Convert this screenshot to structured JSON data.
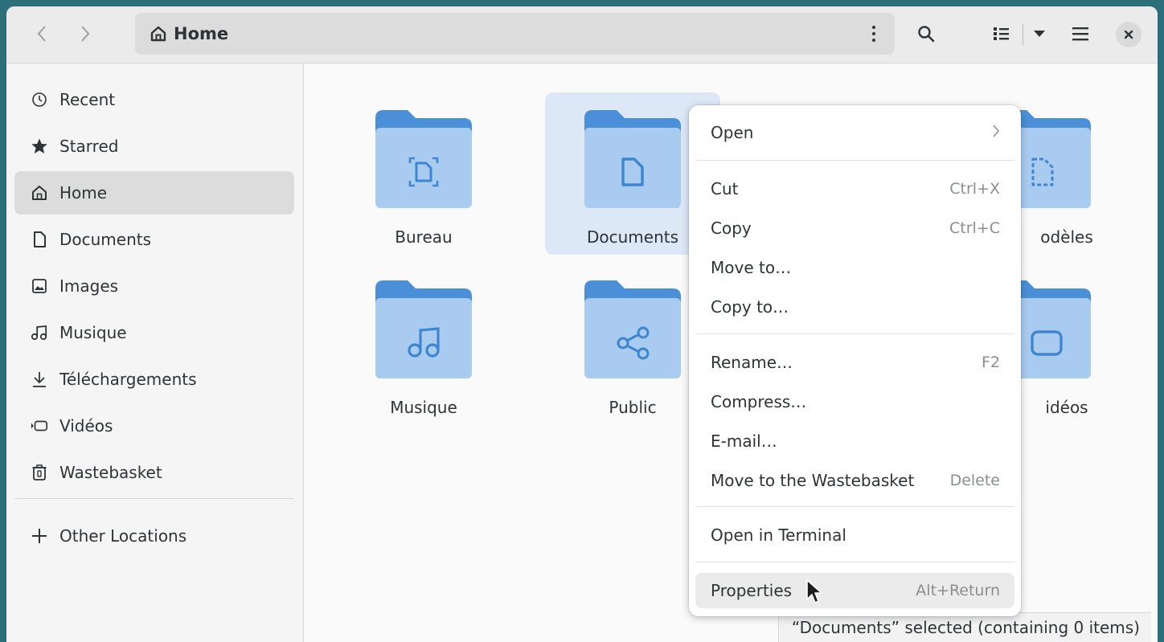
{
  "header": {
    "back_icon": "chevron-left-icon",
    "forward_icon": "chevron-right-icon",
    "location": "Home",
    "location_icon": "home-icon"
  },
  "sidebar": {
    "items": [
      {
        "label": "Recent",
        "icon": "clock-icon"
      },
      {
        "label": "Starred",
        "icon": "star-icon"
      },
      {
        "label": "Home",
        "icon": "home-icon",
        "active": true
      },
      {
        "label": "Documents",
        "icon": "document-icon"
      },
      {
        "label": "Images",
        "icon": "image-icon"
      },
      {
        "label": "Musique",
        "icon": "music-icon"
      },
      {
        "label": "Téléchargements",
        "icon": "download-icon"
      },
      {
        "label": "Vidéos",
        "icon": "video-icon"
      },
      {
        "label": "Wastebasket",
        "icon": "trash-icon"
      }
    ],
    "other_locations": "Other Locations"
  },
  "folders": [
    {
      "label": "Bureau",
      "emblem": "desktop-icon"
    },
    {
      "label": "Documents",
      "emblem": "document-icon",
      "selected": true
    },
    {
      "label": "odèles",
      "emblem": "template-icon"
    },
    {
      "label": "Musique",
      "emblem": "music-icon"
    },
    {
      "label": "Public",
      "emblem": "share-icon"
    },
    {
      "label": "idéos",
      "emblem": "video-icon"
    }
  ],
  "context_menu": {
    "open": "Open",
    "cut": "Cut",
    "cut_shortcut": "Ctrl+X",
    "copy": "Copy",
    "copy_shortcut": "Ctrl+C",
    "move_to": "Move to…",
    "copy_to": "Copy to…",
    "rename": "Rename…",
    "rename_shortcut": "F2",
    "compress": "Compress…",
    "email": "E-mail…",
    "trash": "Move to the Wastebasket",
    "trash_shortcut": "Delete",
    "terminal": "Open in Terminal",
    "properties": "Properties",
    "properties_shortcut": "Alt+Return"
  },
  "status": "“Documents” selected (containing 0 items)",
  "colors": {
    "folder_back": "#4a8fd8",
    "folder_front": "#a9cbf0",
    "emblem": "#3f86d1",
    "selection": "#dde8f7"
  }
}
